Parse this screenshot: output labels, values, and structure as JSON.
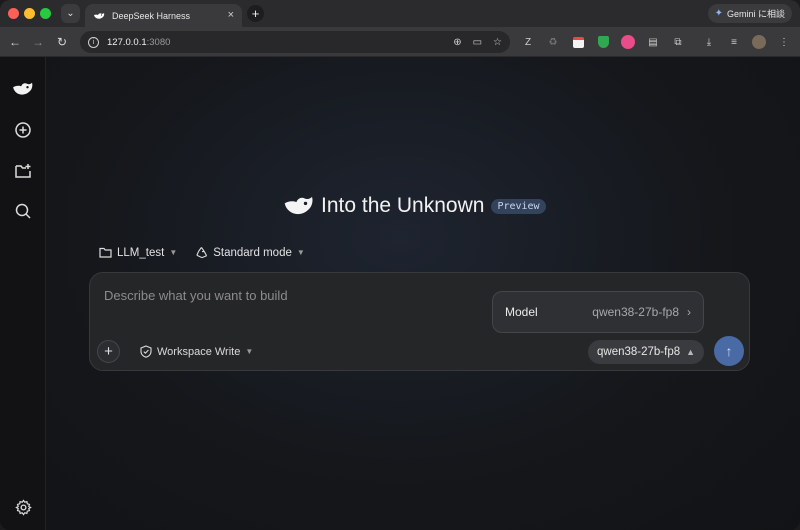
{
  "browser": {
    "tab_title": "DeepSeek Harness",
    "tab_close": "×",
    "new_tab": "+",
    "url_host": "127.0.0.1",
    "url_port": ":3080",
    "gemini_label": "Gemini に相談"
  },
  "sidebar": {
    "items": [
      {
        "icon": "deepseek-logo-icon"
      },
      {
        "icon": "new-chat-icon"
      },
      {
        "icon": "new-folder-icon"
      },
      {
        "icon": "search-icon"
      },
      {
        "icon": "settings-gear-icon"
      }
    ]
  },
  "hero": {
    "title": "Into the Unknown",
    "badge": "Preview"
  },
  "chips": {
    "project": "LLM_test",
    "mode": "Standard mode"
  },
  "composer": {
    "placeholder": "Describe what you want to build",
    "add_label": "+",
    "permission": "Workspace Write",
    "model": "qwen38-27b-fp8"
  },
  "model_popover": {
    "label": "Model",
    "value": "qwen38-27b-fp8"
  },
  "colors": {
    "accent": "#4a6aa6",
    "badge_bg": "#34435c",
    "background": "#15171b"
  }
}
